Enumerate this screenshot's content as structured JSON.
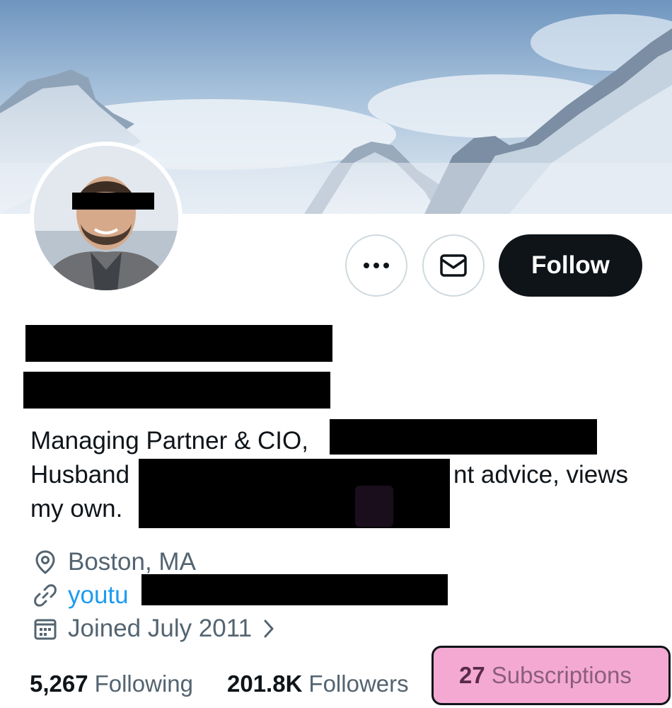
{
  "profile": {
    "follow_label": "Follow",
    "bio_line1": "Managing Partner & CIO,",
    "bio_line2_start": "Husband",
    "bio_line2_end": "nt advice, views",
    "bio_line3": "my own.",
    "location": "Boston, MA",
    "link_visible": "youtu",
    "joined": "Joined July 2011",
    "stats": {
      "following_count": "5,267",
      "following_label": "Following",
      "followers_count": "201.8K",
      "followers_label": "Followers",
      "subscriptions_count": "27",
      "subscriptions_label": "Subscriptions"
    }
  },
  "icons": {
    "more": "more-icon",
    "message": "mail-icon",
    "location": "location-pin-icon",
    "link": "link-icon",
    "joined": "calendar-icon",
    "chevron": "chevron-right-icon"
  },
  "colors": {
    "text_primary": "#0f1419",
    "text_secondary": "#536471",
    "link": "#1d9bf0",
    "follow_bg": "#0f1419",
    "highlight": "#f4a9d3"
  }
}
